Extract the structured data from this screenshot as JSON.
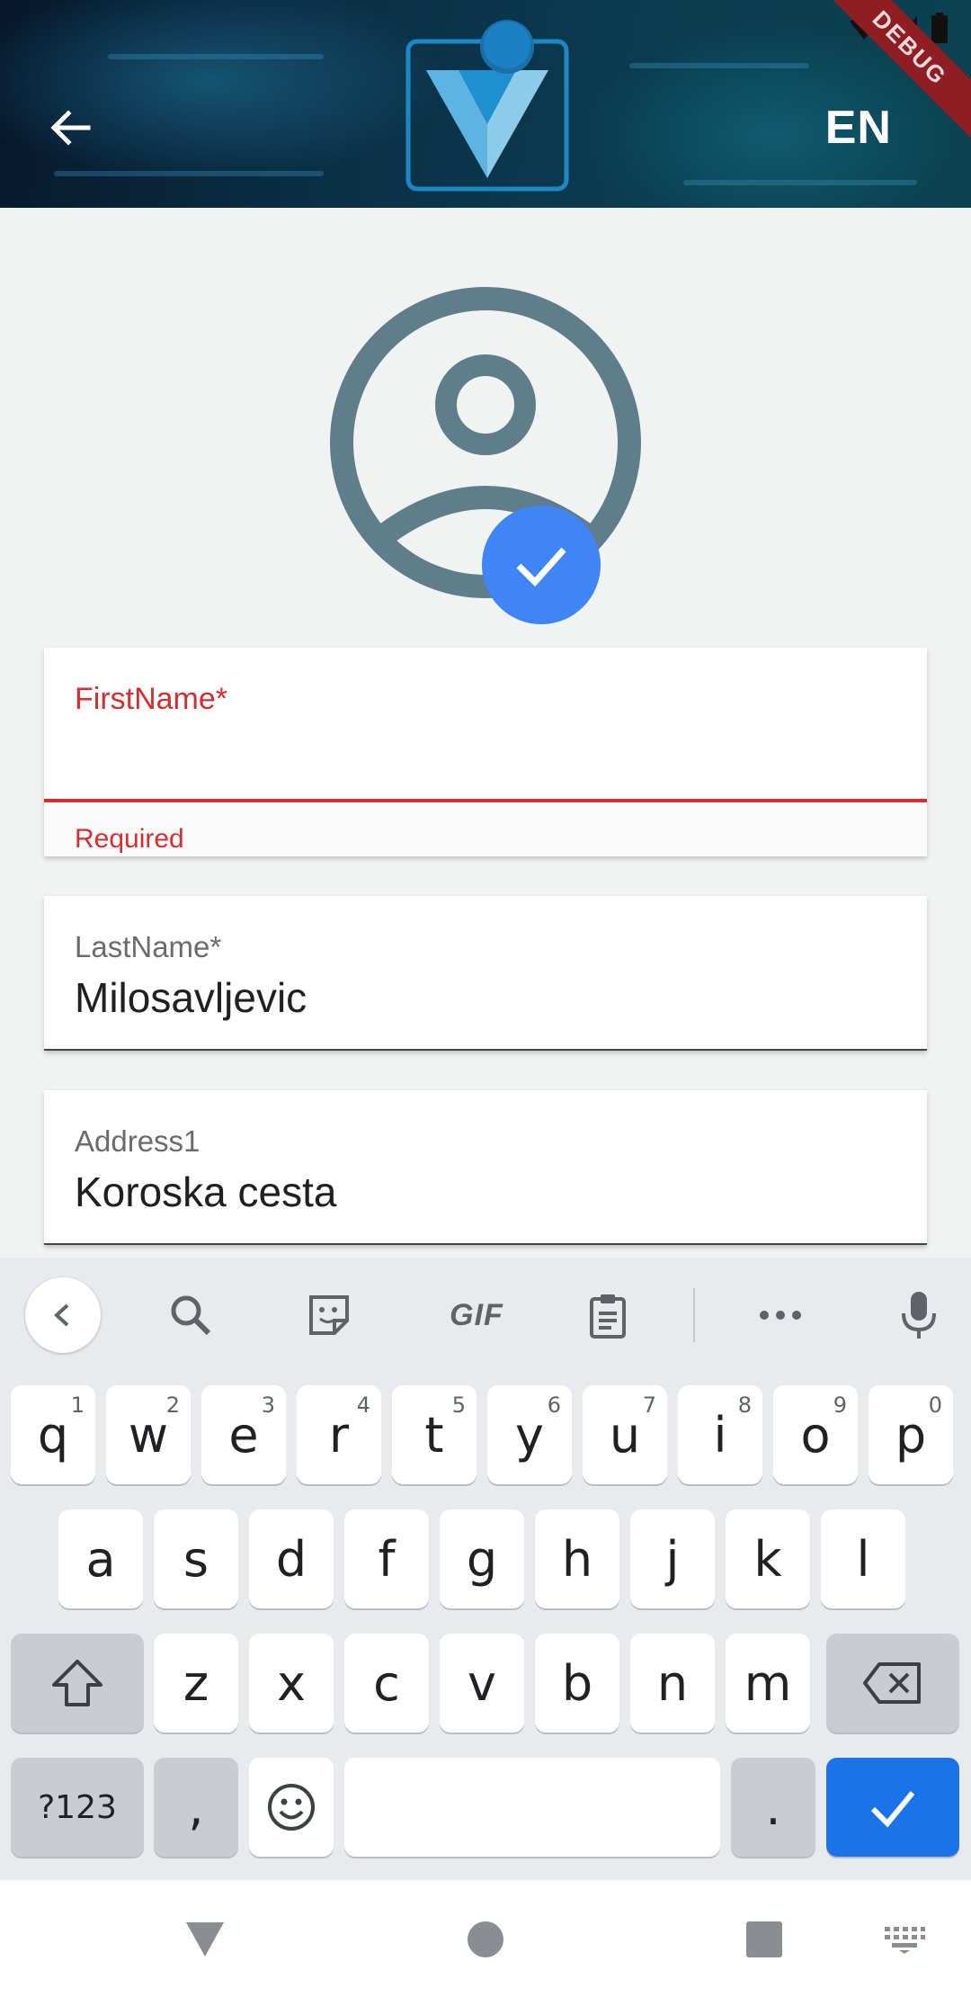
{
  "header": {
    "language": "EN",
    "debug_label": "DEBUG"
  },
  "form": {
    "first_name": {
      "label": "FirstName*",
      "value": "",
      "error": "Required"
    },
    "last_name": {
      "label": "LastName*",
      "value": "Milosavljevic"
    },
    "address1": {
      "label": "Address1",
      "value": "Koroska cesta"
    }
  },
  "keyboard": {
    "toolbar": {
      "gif_label": "GIF"
    },
    "row1": [
      {
        "key": "q",
        "hint": "1"
      },
      {
        "key": "w",
        "hint": "2"
      },
      {
        "key": "e",
        "hint": "3"
      },
      {
        "key": "r",
        "hint": "4"
      },
      {
        "key": "t",
        "hint": "5"
      },
      {
        "key": "y",
        "hint": "6"
      },
      {
        "key": "u",
        "hint": "7"
      },
      {
        "key": "i",
        "hint": "8"
      },
      {
        "key": "o",
        "hint": "9"
      },
      {
        "key": "p",
        "hint": "0"
      }
    ],
    "row2": [
      "a",
      "s",
      "d",
      "f",
      "g",
      "h",
      "j",
      "k",
      "l"
    ],
    "row3": [
      "z",
      "x",
      "c",
      "v",
      "b",
      "n",
      "m"
    ],
    "symbols_label": "?123",
    "comma": ",",
    "period": "."
  },
  "colors": {
    "accent": "#3f85f6",
    "error": "#d32f2f",
    "avatar": "#607d8b",
    "keyboard_action": "#1a73e8"
  }
}
